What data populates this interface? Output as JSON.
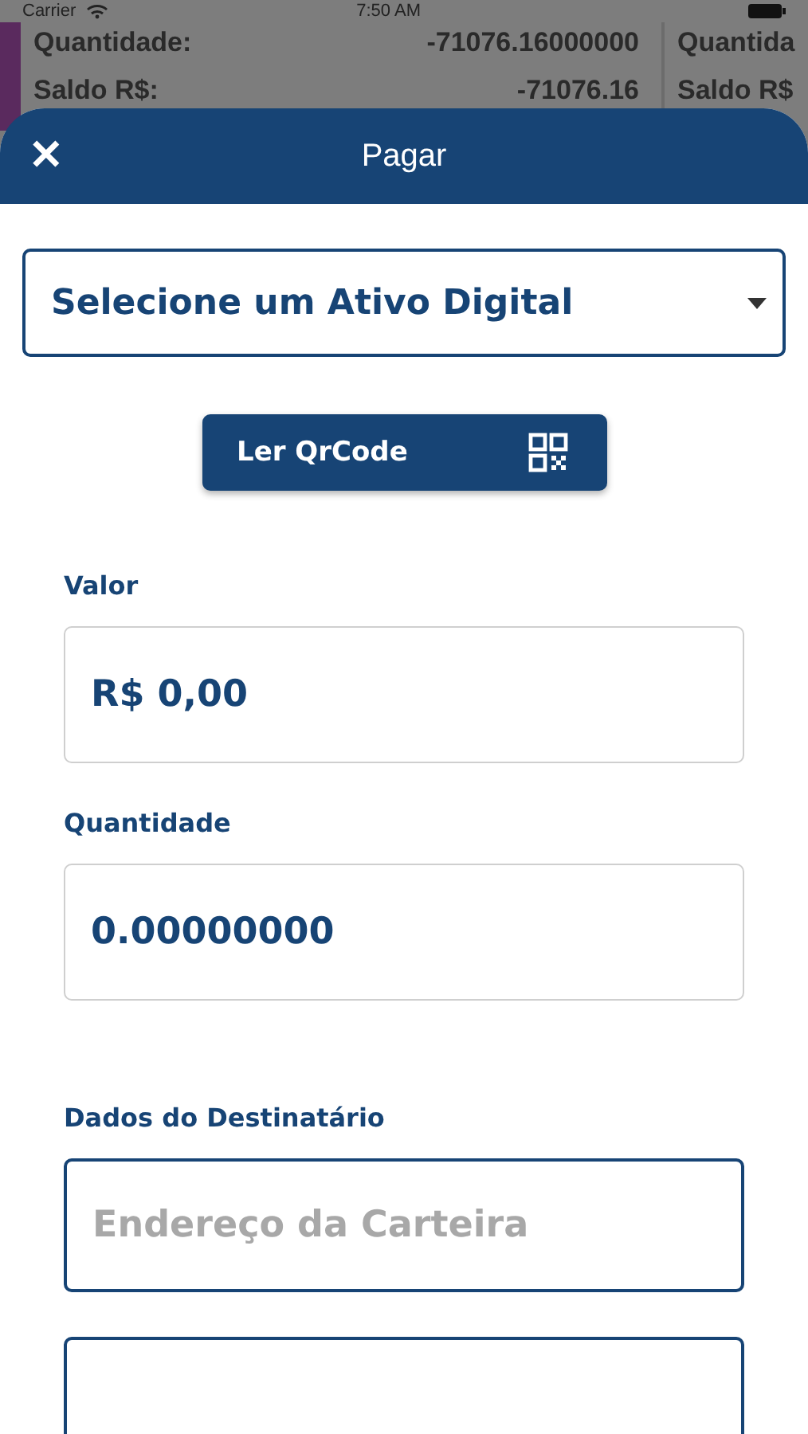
{
  "status_bar": {
    "carrier": "Carrier",
    "time": "7:50 AM"
  },
  "background_cards": [
    {
      "rows": [
        {
          "label": "Quantidade:",
          "value": "-71076.16000000"
        },
        {
          "label": "Saldo R$:",
          "value": "-71076.16"
        }
      ]
    },
    {
      "rows": [
        {
          "label": "Quantida"
        },
        {
          "label": "Saldo R$"
        }
      ]
    }
  ],
  "sheet": {
    "title": "Pagar",
    "close": "✕"
  },
  "asset_select": {
    "placeholder": "Selecione um Ativo Digital"
  },
  "qr_button": {
    "label": "Ler QrCode"
  },
  "fields": [
    {
      "label": "Valor",
      "value": "R$ 0,00",
      "kind": "value"
    },
    {
      "label": "Quantidade",
      "value": "0.00000000",
      "kind": "value"
    },
    {
      "label": "Dados do Destinatário",
      "placeholder": "Endereço da Carteira",
      "kind": "outlined"
    },
    {
      "kind": "outlined"
    }
  ]
}
